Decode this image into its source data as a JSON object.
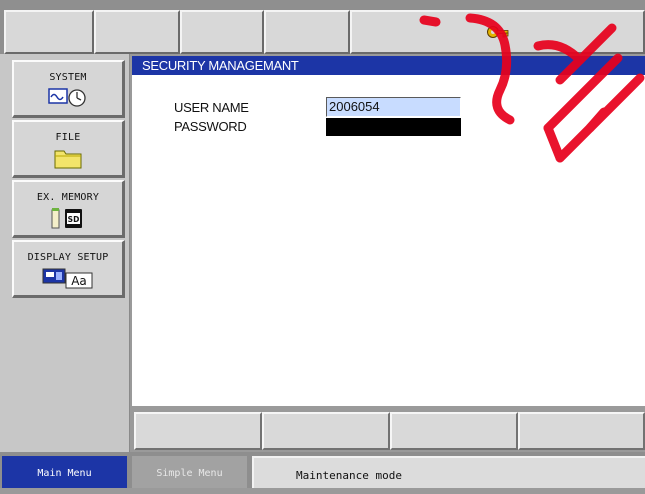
{
  "security_window": {
    "title": "SECURITY MANAGEMANT",
    "user_name_label": "USER NAME",
    "password_label": "PASSWORD",
    "user_name_value": "2006054"
  },
  "left_menu": {
    "items": [
      {
        "label": "SYSTEM",
        "icon": "system-clock-icon"
      },
      {
        "label": "FILE",
        "icon": "folder-icon"
      },
      {
        "label": "EX. MEMORY",
        "icon": "sd-card-icon"
      },
      {
        "label": "DISPLAY SETUP",
        "icon": "display-setup-icon"
      }
    ]
  },
  "top_bar": {
    "status_icon": "key-icon",
    "key_color": "#e2b400"
  },
  "footer": {
    "main_menu": "Main Menu",
    "simple_menu": "Simple Menu",
    "status": "Maintenance mode"
  },
  "colors": {
    "accent_blue": "#1c35a6",
    "input_highlight": "#c8dcff",
    "watermark_red": "#e8001c"
  }
}
